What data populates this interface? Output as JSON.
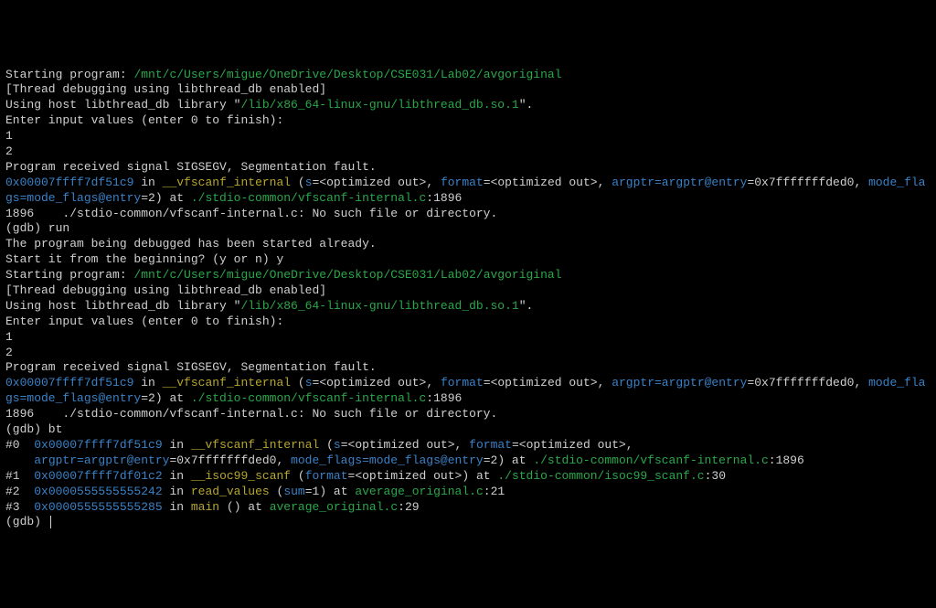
{
  "session1": {
    "starting_label": "Starting program: ",
    "program_path": "/mnt/c/Users/migue/OneDrive/Desktop/CSE031/Lab02/avgoriginal",
    "thread_debug": "[Thread debugging using libthread_db enabled]",
    "host_lib_prefix": "Using host libthread_db library \"",
    "host_lib_path": "/lib/x86_64-linux-gnu/libthread_db.so.1",
    "host_lib_suffix": "\".",
    "input_prompt": "Enter input values (enter 0 to finish):",
    "input1": "1",
    "input2": "2"
  },
  "fault1": {
    "empty": "",
    "signal_msg": "Program received signal SIGSEGV, Segmentation fault.",
    "addr1": "0x00007ffff7df51c9",
    "in": " in ",
    "func1": "__vfscanf_internal",
    "paren_open": " (",
    "s_var": "s",
    "s_val": "=<optimized out>, ",
    "format_var": "format",
    "format_val": "=<optimized out>, ",
    "argptr_var": "argptr=argptr@entry",
    "argptr_val": "=0x7fffffffded0, ",
    "mode_var": "mode_flags=mode_flags@entry",
    "mode_val": "=2) at ",
    "src_path": "./stdio-common/vfscanf-internal.c",
    "src_line": ":1896",
    "nofile": "1896    ./stdio-common/vfscanf-internal.c: No such file or directory.",
    "gdb_run": "(gdb) run",
    "already": "The program being debugged has been started already.",
    "restart": "Start it from the beginning? (y or n) y"
  },
  "session2": {
    "starting_label": "Starting program: ",
    "program_path": "/mnt/c/Users/migue/OneDrive/Desktop/CSE031/Lab02/avgoriginal",
    "thread_debug": "[Thread debugging using libthread_db enabled]",
    "host_lib_prefix": "Using host libthread_db library \"",
    "host_lib_path": "/lib/x86_64-linux-gnu/libthread_db.so.1",
    "host_lib_suffix": "\".",
    "input_prompt": "Enter input values (enter 0 to finish):",
    "input1": "1",
    "input2": "2"
  },
  "fault2": {
    "empty": "",
    "signal_msg": "Program received signal SIGSEGV, Segmentation fault.",
    "addr1": "0x00007ffff7df51c9",
    "in": " in ",
    "func1": "__vfscanf_internal",
    "paren_open": " (",
    "s_var": "s",
    "s_val": "=<optimized out>, ",
    "format_var": "format",
    "format_val": "=<optimized out>, ",
    "argptr_var": "argptr=argptr@entry",
    "argptr_val": "=0x7fffffffded0, ",
    "mode_var": "mode_flags=mode_flags@entry",
    "mode_val": "=2) at ",
    "src_path": "./stdio-common/vfscanf-internal.c",
    "src_line": ":1896",
    "nofile": "1896    ./stdio-common/vfscanf-internal.c: No such file or directory.",
    "gdb_bt": "(gdb) bt"
  },
  "bt": {
    "f0_num": "#0  ",
    "f0_addr": "0x00007ffff7df51c9",
    "f0_in": " in ",
    "f0_func": "__vfscanf_internal",
    "f0_open": " (",
    "f0_s": "s",
    "f0_s_val": "=<optimized out>, ",
    "f0_format": "format",
    "f0_format_val": "=<optimized out>,",
    "f0_indent": "    ",
    "f0_argptr": "argptr=argptr@entry",
    "f0_argptr_val": "=0x7fffffffded0, ",
    "f0_mode": "mode_flags=mode_flags@entry",
    "f0_mode_val": "=2) at ",
    "f0_src": "./stdio-common/vfscanf-internal.c",
    "f0_line": ":1896",
    "f1_num": "#1  ",
    "f1_addr": "0x00007ffff7df01c2",
    "f1_in": " in ",
    "f1_func": "__isoc99_scanf",
    "f1_open": " (",
    "f1_format": "format",
    "f1_format_val": "=<optimized out>) at ",
    "f1_src": "./stdio-common/isoc99_scanf.c",
    "f1_line": ":30",
    "f2_num": "#2  ",
    "f2_addr": "0x0000555555555242",
    "f2_in": " in ",
    "f2_func": "read_values",
    "f2_open": " (",
    "f2_sum": "sum",
    "f2_sum_val": "=1) at ",
    "f2_src": "average_original.c",
    "f2_line": ":21",
    "f3_num": "#3  ",
    "f3_addr": "0x0000555555555285",
    "f3_in": " in ",
    "f3_func": "main",
    "f3_rest": " () at ",
    "f3_src": "average_original.c",
    "f3_line": ":29",
    "prompt": "(gdb) "
  }
}
